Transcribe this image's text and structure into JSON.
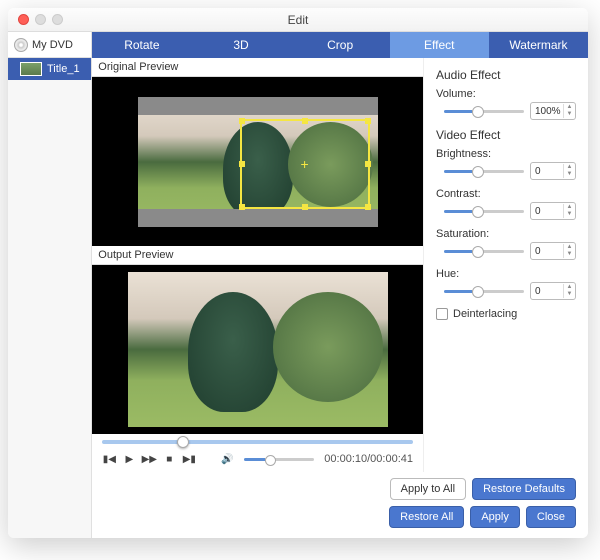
{
  "window": {
    "title": "Edit"
  },
  "sidebar": {
    "disc_label": "My DVD",
    "items": [
      {
        "label": "Title_1"
      }
    ]
  },
  "tabs": [
    {
      "label": "Rotate"
    },
    {
      "label": "3D"
    },
    {
      "label": "Crop"
    },
    {
      "label": "Effect",
      "active": true
    },
    {
      "label": "Watermark"
    }
  ],
  "preview": {
    "original_label": "Original Preview",
    "output_label": "Output Preview"
  },
  "transport": {
    "time_display": "00:00:10/00:00:41"
  },
  "effects": {
    "audio_header": "Audio Effect",
    "volume_label": "Volume:",
    "volume_value": "100%",
    "video_header": "Video Effect",
    "brightness_label": "Brightness:",
    "brightness_value": "0",
    "contrast_label": "Contrast:",
    "contrast_value": "0",
    "saturation_label": "Saturation:",
    "saturation_value": "0",
    "hue_label": "Hue:",
    "hue_value": "0",
    "deinterlacing_label": "Deinterlacing"
  },
  "footer": {
    "apply_all": "Apply to All",
    "restore_defaults": "Restore Defaults",
    "restore_all": "Restore All",
    "apply": "Apply",
    "close": "Close"
  }
}
